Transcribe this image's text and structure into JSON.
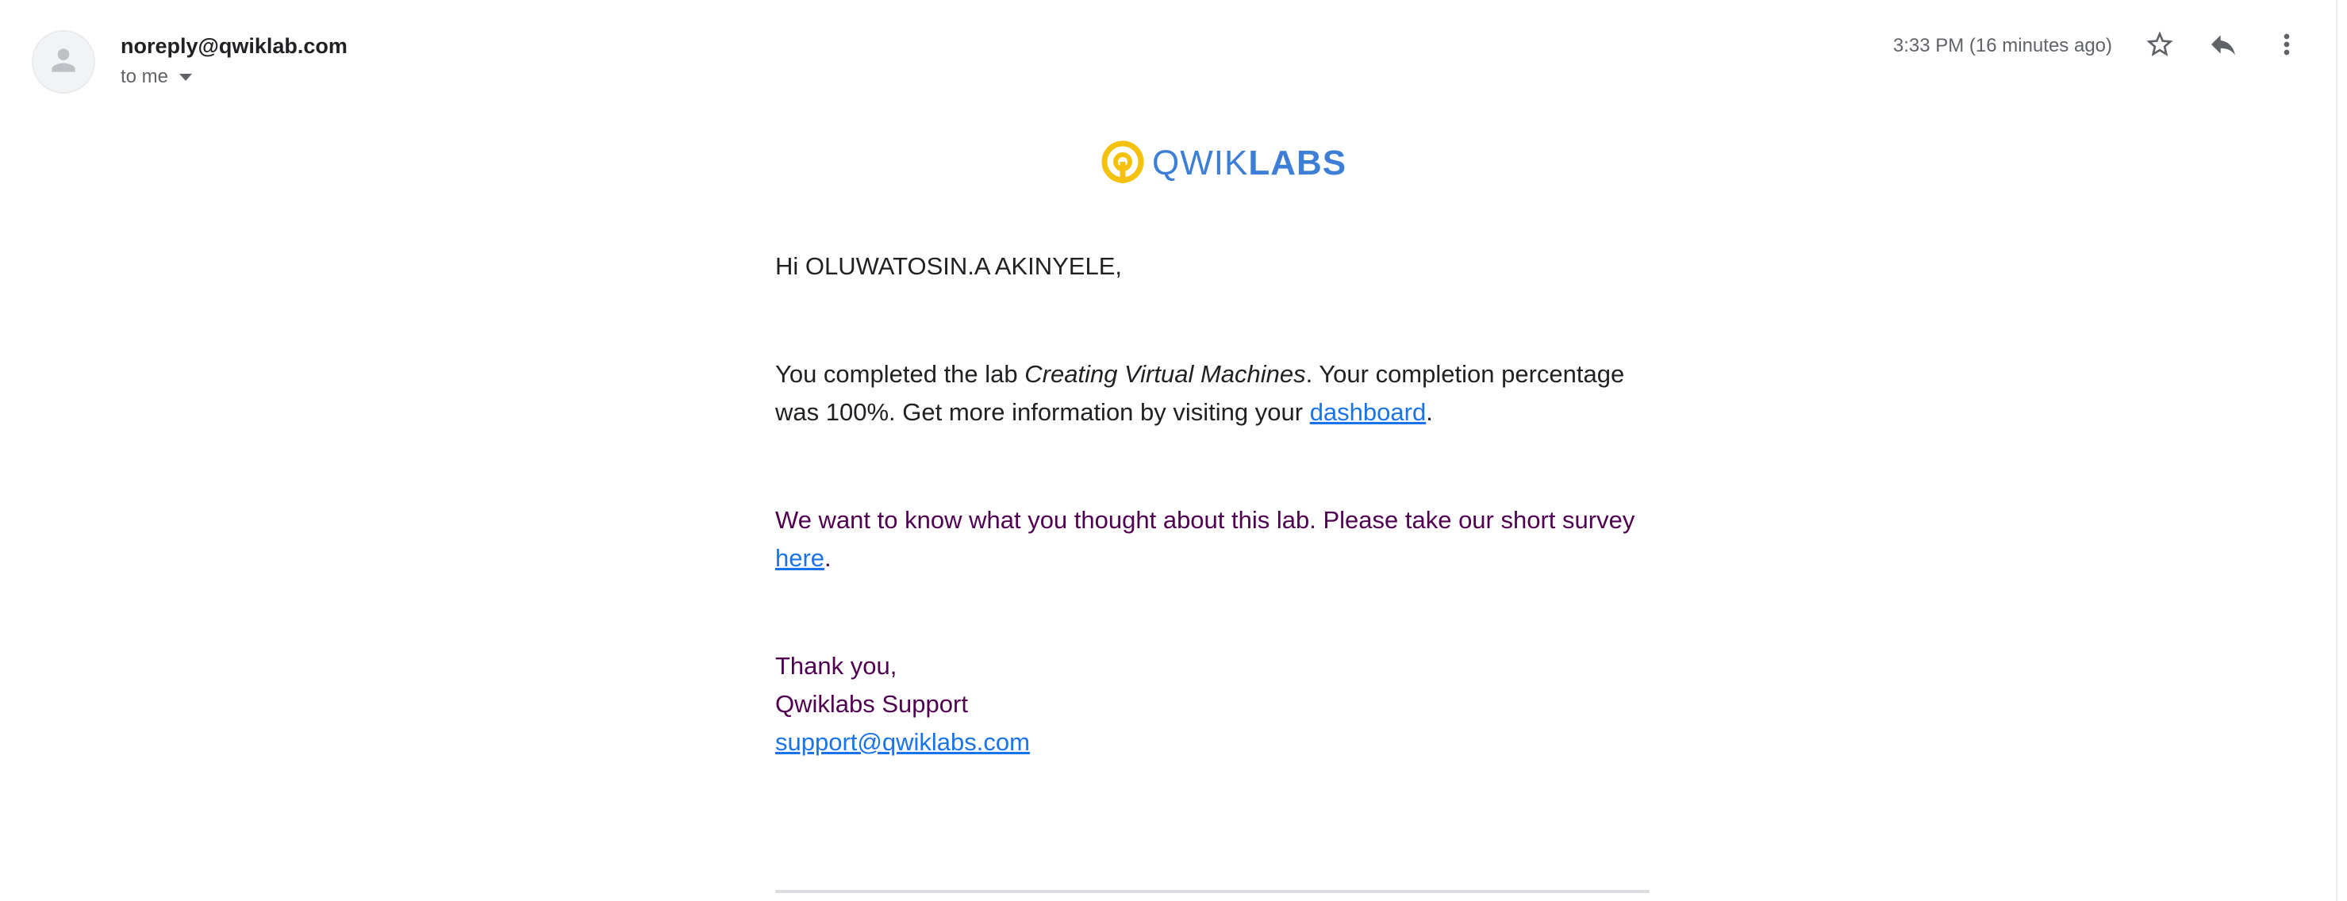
{
  "header": {
    "sender": "noreply@qwiklab.com",
    "recipient": "to me",
    "timestamp": "3:33 PM (16 minutes ago)",
    "icons": [
      "person-icon",
      "star-icon",
      "reply-icon",
      "more-vert-icon"
    ]
  },
  "logo": {
    "text_light": "QWIK",
    "text_bold": "LABS",
    "colors": {
      "mark": "#f4c20d",
      "text": "#3d7fd6"
    }
  },
  "email": {
    "greeting": "Hi OLUWATOSIN.A AKINYELE,",
    "para1": {
      "prefix": "You completed the lab ",
      "lab_name": "Creating Virtual Machines",
      "middle": ". Your completion percentage was 100%. Get more information by visiting your ",
      "link": "dashboard",
      "suffix": "."
    },
    "para2": {
      "prefix": "We want to know what you thought about this lab. Please take our short survey ",
      "link": "here",
      "suffix": "."
    },
    "signoff": {
      "line1": "Thank you,",
      "line2": "Qwiklabs Support",
      "email": "support@qwiklabs.com"
    }
  },
  "colors": {
    "link": "#1a73e8",
    "quoted_text": "#500050",
    "primary_text": "#202124",
    "secondary_text": "#5f6368"
  }
}
